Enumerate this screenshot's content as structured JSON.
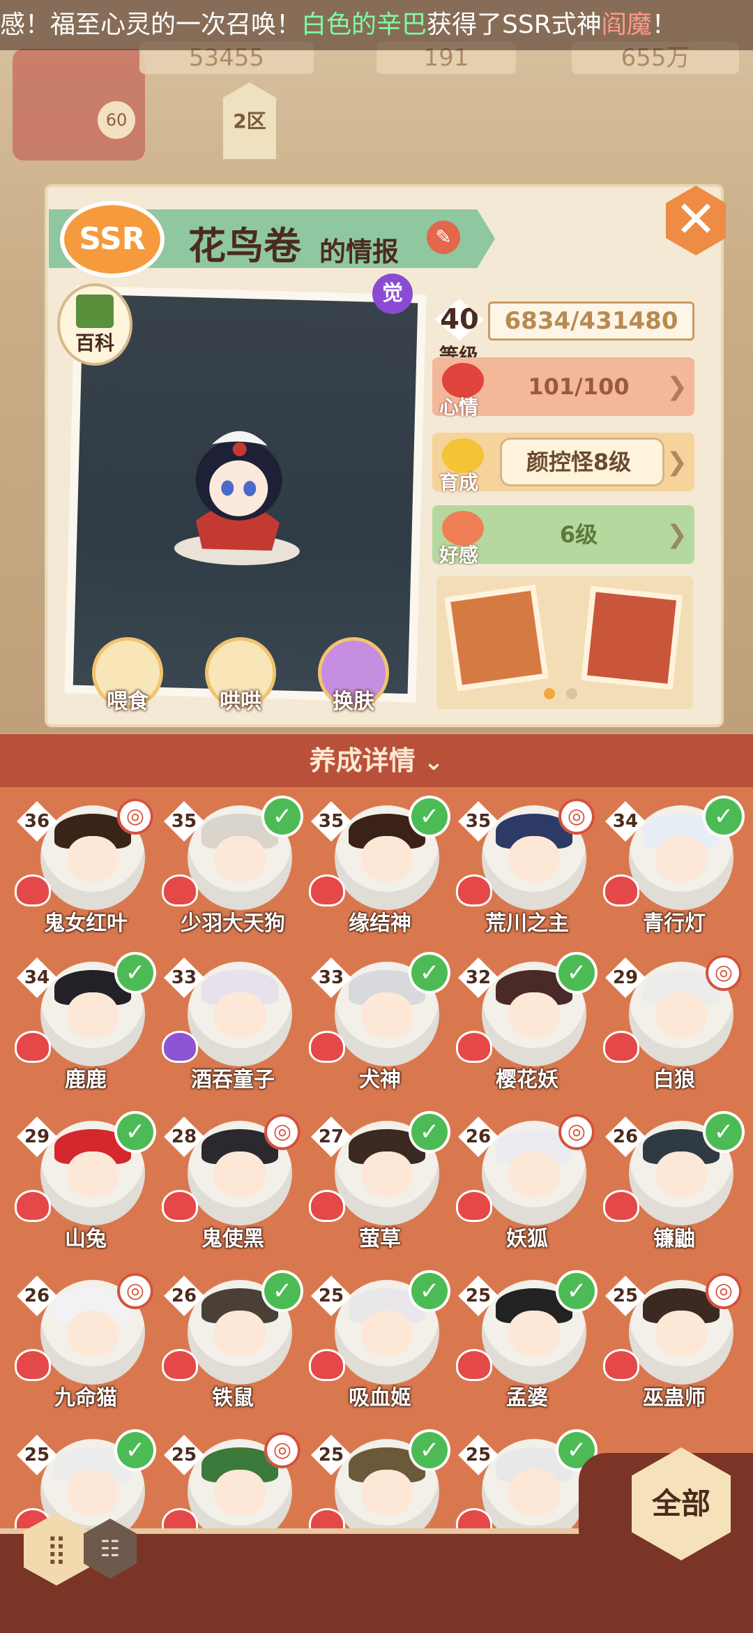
{
  "ticker": {
    "part1": "感！福至心灵的一次召唤！",
    "player": "白色的辛巴",
    "part2": "获得了SSR式神",
    "shikigami": "阎魔",
    "part3": "！"
  },
  "resources": [
    "53455",
    "191",
    "655万"
  ],
  "player_level": "60",
  "area": "2区",
  "panel": {
    "rarity": "SSR",
    "name": "花鸟卷",
    "name_suffix": "的情报",
    "baike_label": "百科",
    "awaken_label": "觉",
    "actions": [
      "喂食",
      "哄哄",
      "换肤"
    ],
    "level": "40",
    "level_label": "等级",
    "exp": "6834/431480",
    "mood_label": "心情",
    "mood_value": "101/100",
    "grow_label": "育成",
    "grow_value": "颜控怪8级",
    "favor_label": "好感",
    "favor_value": "6级"
  },
  "detail_label": "养成详情",
  "detail_chevron": "⌄",
  "roster": [
    {
      "name": "鬼女红叶",
      "level": "36",
      "status": "sym",
      "heart": "red",
      "hair": "#3a2418"
    },
    {
      "name": "少羽大天狗",
      "level": "35",
      "status": "check",
      "heart": "red",
      "hair": "#d9d4cc"
    },
    {
      "name": "缘结神",
      "level": "35",
      "status": "check",
      "heart": "red",
      "hair": "#3b2219"
    },
    {
      "name": "荒川之主",
      "level": "35",
      "status": "sym",
      "heart": "red",
      "hair": "#2e3a66"
    },
    {
      "name": "青行灯",
      "level": "34",
      "status": "check",
      "heart": "red",
      "hair": "#e8eef5"
    },
    {
      "name": "鹿鹿",
      "level": "34",
      "status": "check",
      "heart": "red",
      "hair": "#222226"
    },
    {
      "name": "酒吞童子",
      "level": "33",
      "status": "none",
      "heart": "purple",
      "hair": "#e6e1ea"
    },
    {
      "name": "犬神",
      "level": "33",
      "status": "check",
      "heart": "red",
      "hair": "#d7d9dd"
    },
    {
      "name": "樱花妖",
      "level": "32",
      "status": "check",
      "heart": "red",
      "hair": "#4a2a26"
    },
    {
      "name": "白狼",
      "level": "29",
      "status": "sym",
      "heart": "red",
      "hair": "#ececec"
    },
    {
      "name": "山兔",
      "level": "29",
      "status": "check",
      "heart": "red",
      "hair": "#d4282e"
    },
    {
      "name": "鬼使黑",
      "level": "28",
      "status": "sym",
      "heart": "red",
      "hair": "#2a2a2e"
    },
    {
      "name": "萤草",
      "level": "27",
      "status": "check",
      "heart": "red",
      "hair": "#3a2a22"
    },
    {
      "name": "妖狐",
      "level": "26",
      "status": "sym",
      "heart": "red",
      "hair": "#ecebf2"
    },
    {
      "name": "镰鼬",
      "level": "26",
      "status": "check",
      "heart": "red",
      "hair": "#2f3a44"
    },
    {
      "name": "九命猫",
      "level": "26",
      "status": "sym",
      "heart": "red",
      "hair": "#f2f2f4"
    },
    {
      "name": "铁鼠",
      "level": "26",
      "status": "check",
      "heart": "red",
      "hair": "#4a4036"
    },
    {
      "name": "吸血姬",
      "level": "25",
      "status": "check",
      "heart": "red",
      "hair": "#e9e7ea"
    },
    {
      "name": "孟婆",
      "level": "25",
      "status": "check",
      "heart": "red",
      "hair": "#222"
    },
    {
      "name": "巫蛊师",
      "level": "25",
      "status": "sym",
      "heart": "red",
      "hair": "#3c2a22"
    },
    {
      "name": "",
      "level": "25",
      "status": "check",
      "heart": "red",
      "hair": "#ececec"
    },
    {
      "name": "",
      "level": "25",
      "status": "sym",
      "heart": "red",
      "hair": "#3b7a3a"
    },
    {
      "name": "",
      "level": "25",
      "status": "check",
      "heart": "red",
      "hair": "#6b5a3a"
    },
    {
      "name": "",
      "level": "25",
      "status": "check",
      "heart": "red",
      "hair": "#e8e8e8"
    }
  ],
  "bottom": {
    "filter_label": "全部",
    "grid_icon": "grid-view-icon",
    "list_icon": "list-view-icon"
  },
  "colors": {
    "panel": "#f4e9d4",
    "ribbon": "#8fc7a1",
    "grid_bg": "#d9784e",
    "detail_bar": "#b9503a",
    "check": "#4dbb55"
  }
}
